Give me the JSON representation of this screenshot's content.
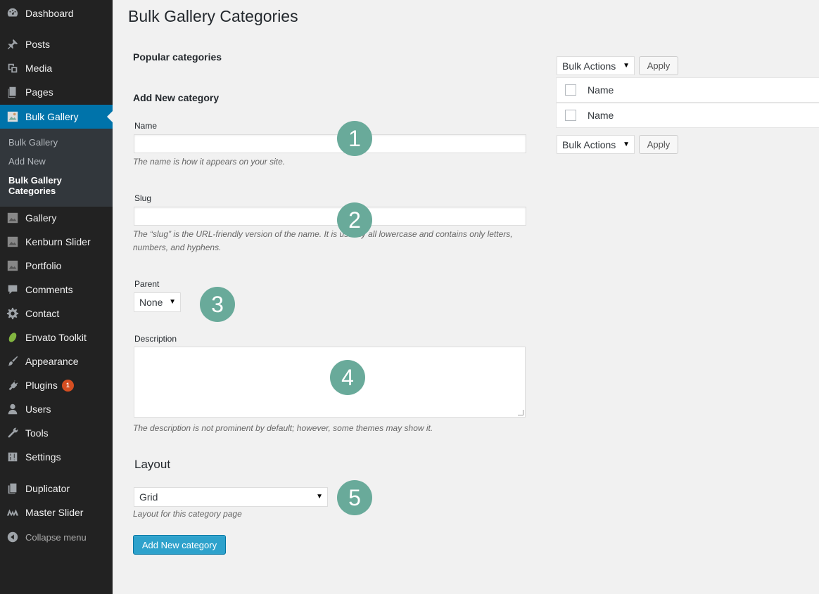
{
  "sidebar": {
    "items": [
      {
        "label": "Dashboard",
        "icon": "dashboard-icon"
      },
      {
        "label": "Posts",
        "icon": "pin-icon"
      },
      {
        "label": "Media",
        "icon": "media-icon"
      },
      {
        "label": "Pages",
        "icon": "pages-icon"
      },
      {
        "label": "Bulk Gallery",
        "icon": "gallery-plugin-icon"
      },
      {
        "label": "Gallery",
        "icon": "gallery-plugin-icon"
      },
      {
        "label": "Kenburn Slider",
        "icon": "gallery-plugin-icon"
      },
      {
        "label": "Portfolio",
        "icon": "gallery-plugin-icon"
      },
      {
        "label": "Comments",
        "icon": "comment-icon"
      },
      {
        "label": "Contact",
        "icon": "gear-icon"
      },
      {
        "label": "Envato Toolkit",
        "icon": "leaf-icon"
      },
      {
        "label": "Appearance",
        "icon": "brush-icon"
      },
      {
        "label": "Plugins",
        "icon": "plug-icon",
        "badge": "1"
      },
      {
        "label": "Users",
        "icon": "user-icon"
      },
      {
        "label": "Tools",
        "icon": "wrench-icon"
      },
      {
        "label": "Settings",
        "icon": "settings-icon"
      },
      {
        "label": "Duplicator",
        "icon": "duplicator-icon"
      },
      {
        "label": "Master Slider",
        "icon": "master-slider-icon"
      }
    ],
    "submenu": [
      "Bulk Gallery",
      "Add New",
      "Bulk Gallery Categories"
    ],
    "collapse": "Collapse menu"
  },
  "page": {
    "title": "Bulk Gallery Categories",
    "popular": "Popular categories",
    "add_new_heading": "Add New category"
  },
  "form": {
    "name_label": "Name",
    "name_desc": "The name is how it appears on your site.",
    "slug_label": "Slug",
    "slug_desc_1": "The “slug” is the URL-friendly version of the name. It is usually all lowercase and contains only letters,",
    "slug_desc_2": "numbers, and hyphens.",
    "parent_label": "Parent",
    "parent_value": "None",
    "description_label": "Description",
    "description_desc": "The description is not prominent by default; however, some themes may show it.",
    "layout_heading": "Layout",
    "layout_value": "Grid",
    "layout_desc": "Layout for this category page",
    "submit": "Add New category"
  },
  "markers": [
    "1",
    "2",
    "3",
    "4",
    "5"
  ],
  "table": {
    "bulk_actions": "Bulk Actions",
    "apply": "Apply",
    "column": "Name"
  },
  "colors": {
    "sidebar_bg": "#222222",
    "active": "#0073aa",
    "marker": "#69aa9a",
    "primary_button": "#2ea2cc"
  }
}
